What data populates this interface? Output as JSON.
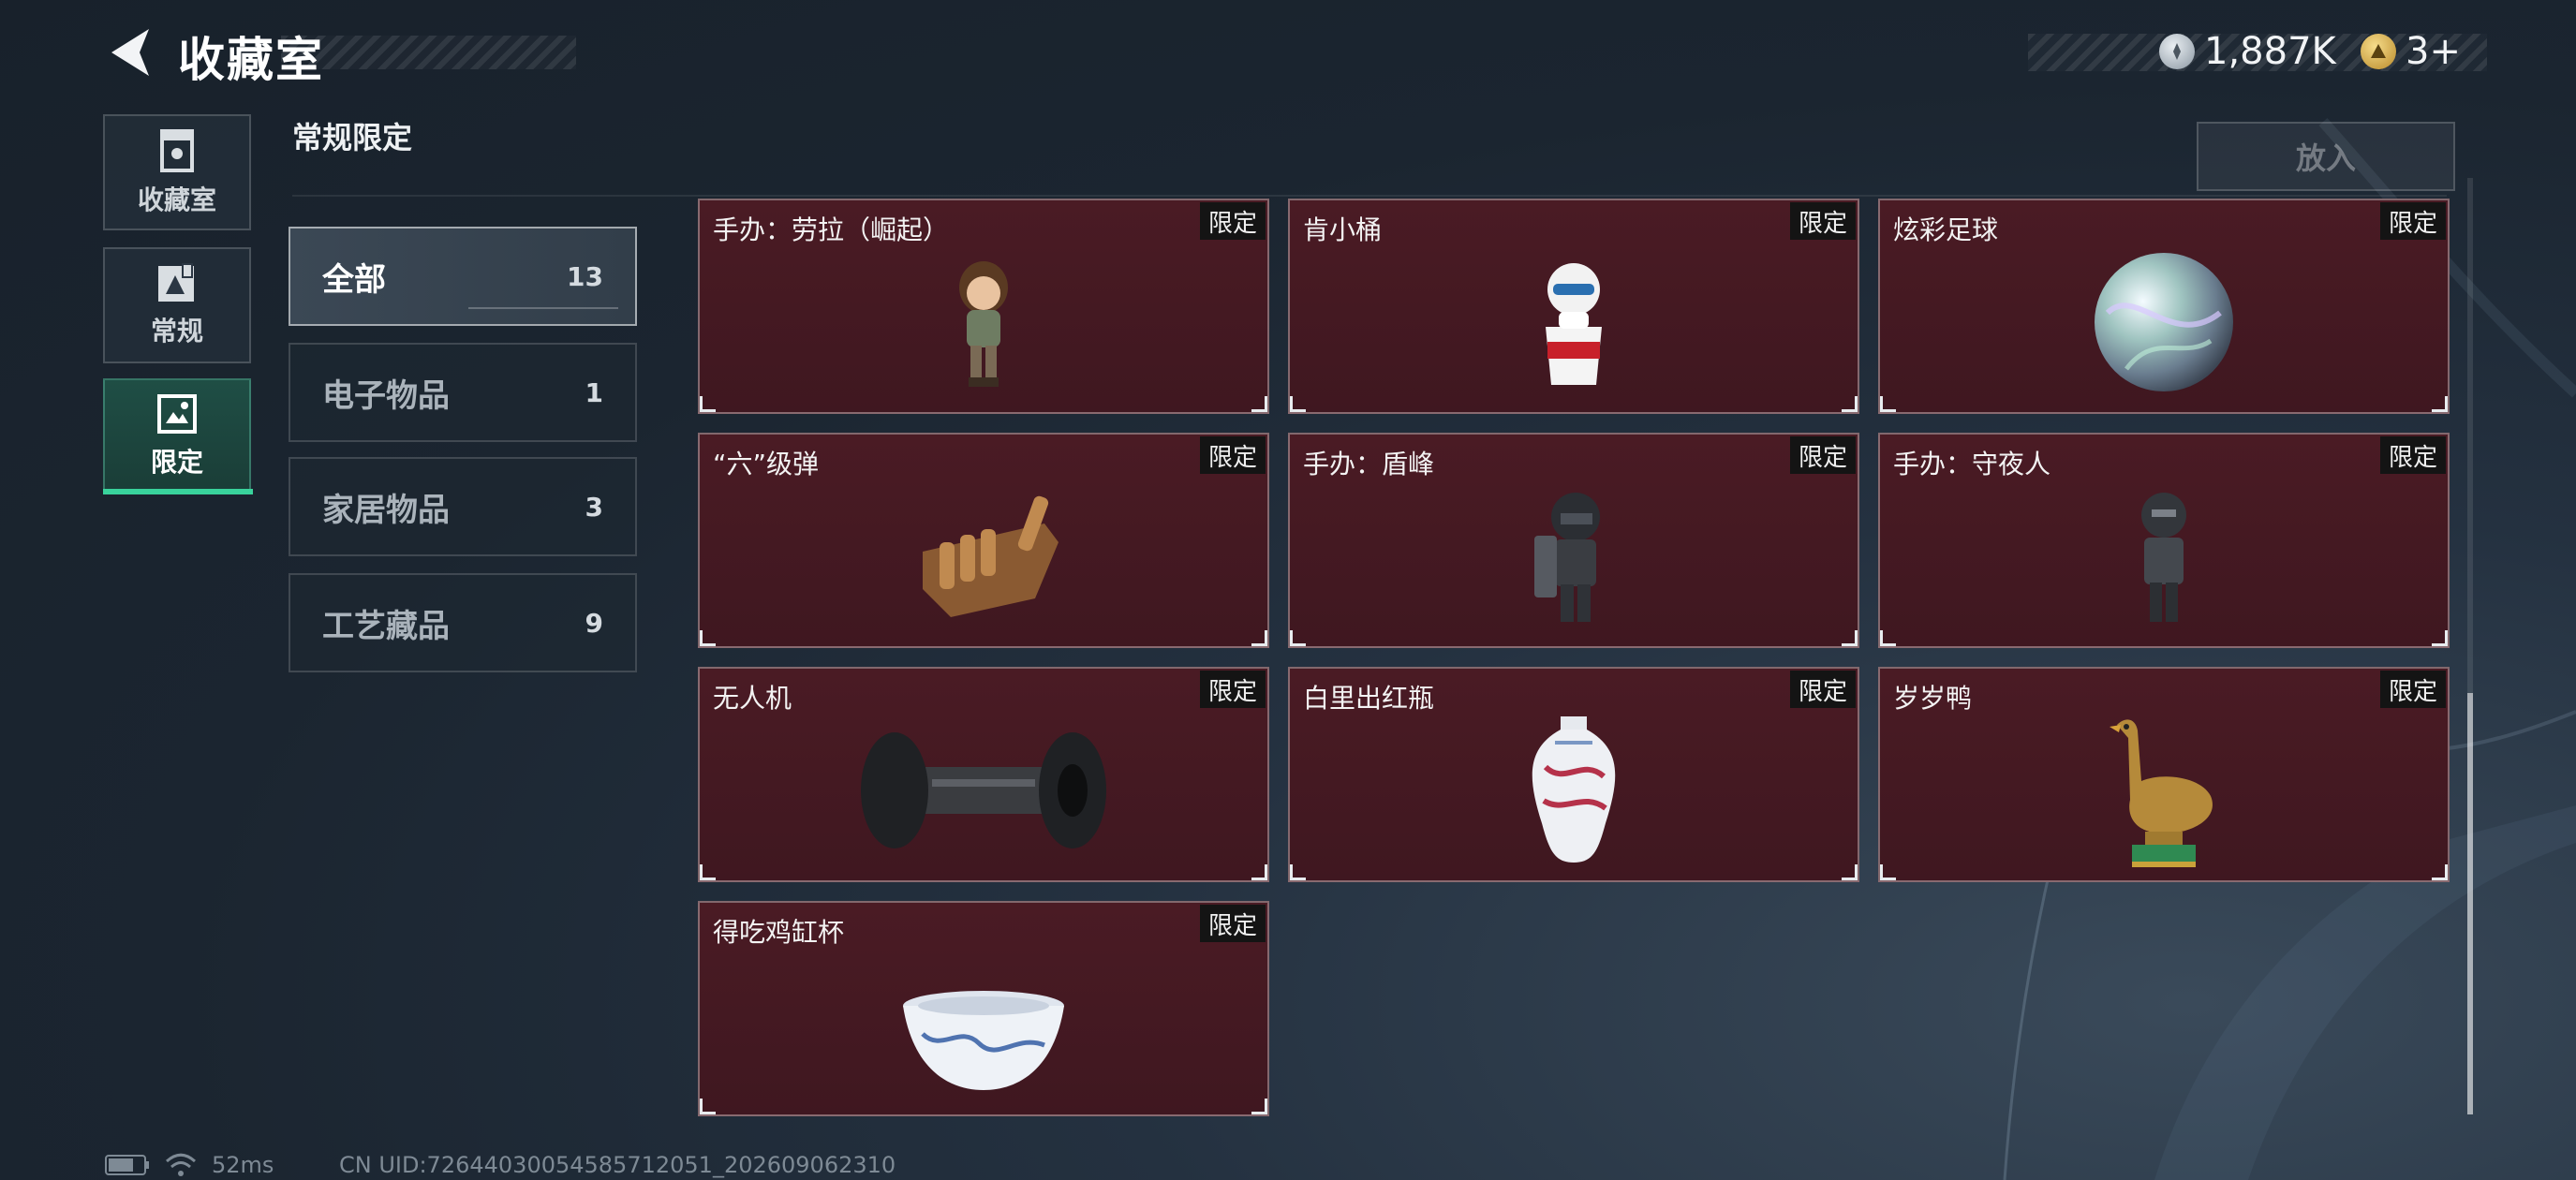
{
  "header": {
    "title": "收藏室",
    "currency_a_value": "1,887K",
    "currency_b_value": "3+"
  },
  "nav": {
    "items": [
      {
        "label": "收藏室",
        "icon": "collection-room-icon"
      },
      {
        "label": "常规",
        "icon": "regular-icon"
      },
      {
        "label": "限定",
        "icon": "limited-icon",
        "active": true
      }
    ]
  },
  "section": {
    "title": "常规限定",
    "put_button": "放入"
  },
  "categories": [
    {
      "label": "全部",
      "count": "13",
      "selected": true
    },
    {
      "label": "电子物品",
      "count": "1"
    },
    {
      "label": "家居物品",
      "count": "3"
    },
    {
      "label": "工艺藏品",
      "count": "9"
    }
  ],
  "items": [
    {
      "name": "手办：劳拉（崛起）",
      "badge": "限定",
      "icon": "figure-lara-icon"
    },
    {
      "name": "肯小桶",
      "badge": "限定",
      "icon": "kfc-bucket-figure-icon"
    },
    {
      "name": "炫彩足球",
      "badge": "限定",
      "icon": "iridescent-ball-icon"
    },
    {
      "name": "“六”级弹",
      "badge": "限定",
      "icon": "bullet-hand-icon"
    },
    {
      "name": "手办：盾峰",
      "badge": "限定",
      "icon": "figure-shield-icon"
    },
    {
      "name": "手办：守夜人",
      "badge": "限定",
      "icon": "figure-nightwatch-icon"
    },
    {
      "name": "无人机",
      "badge": "限定",
      "icon": "drone-icon"
    },
    {
      "name": "白里出红瓶",
      "badge": "限定",
      "icon": "porcelain-vase-icon"
    },
    {
      "name": "岁岁鸭",
      "badge": "限定",
      "icon": "duck-statue-icon"
    },
    {
      "name": "得吃鸡缸杯",
      "badge": "限定",
      "icon": "chicken-cup-icon"
    }
  ],
  "status": {
    "ping": "52ms",
    "uid": "CN UID:72644030054585712051_202609062310"
  },
  "colors": {
    "accent": "#39d39c",
    "card_bg": "#4a1b24",
    "badge_bg": "#141414"
  }
}
